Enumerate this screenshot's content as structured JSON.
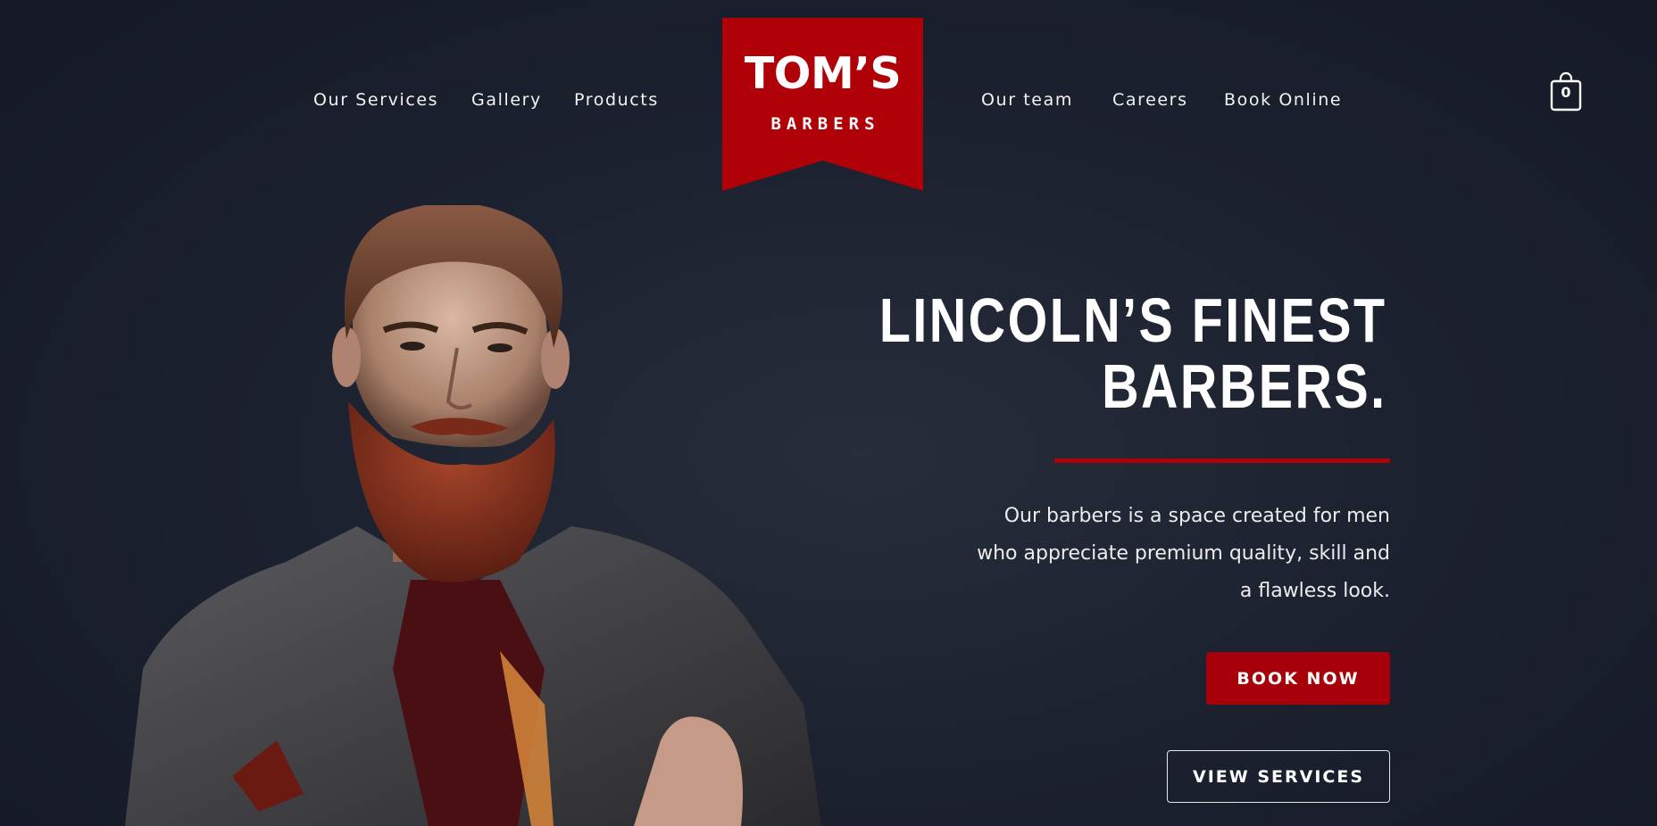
{
  "nav": {
    "left": [
      "Our Services",
      "Gallery",
      "Products"
    ],
    "right": [
      "Our team",
      "Careers",
      "Book Online"
    ]
  },
  "logo": {
    "title": "TOM’S",
    "subtitle": "BARBERS",
    "color": "#b00008"
  },
  "cart": {
    "icon": "shopping-bag-icon",
    "count": "0"
  },
  "hero": {
    "headline_line1": "LINCOLN’S FINEST",
    "headline_line2": "BARBERS.",
    "description": "Our barbers is a space created for men who appreciate premium quality, skill and a flawless look.",
    "book_button": "BOOK NOW",
    "services_button": "VIEW SERVICES",
    "image": "bearded-man-portrait"
  },
  "colors": {
    "accent": "#b00008",
    "background": "#1d2230",
    "text": "#ffffff"
  }
}
